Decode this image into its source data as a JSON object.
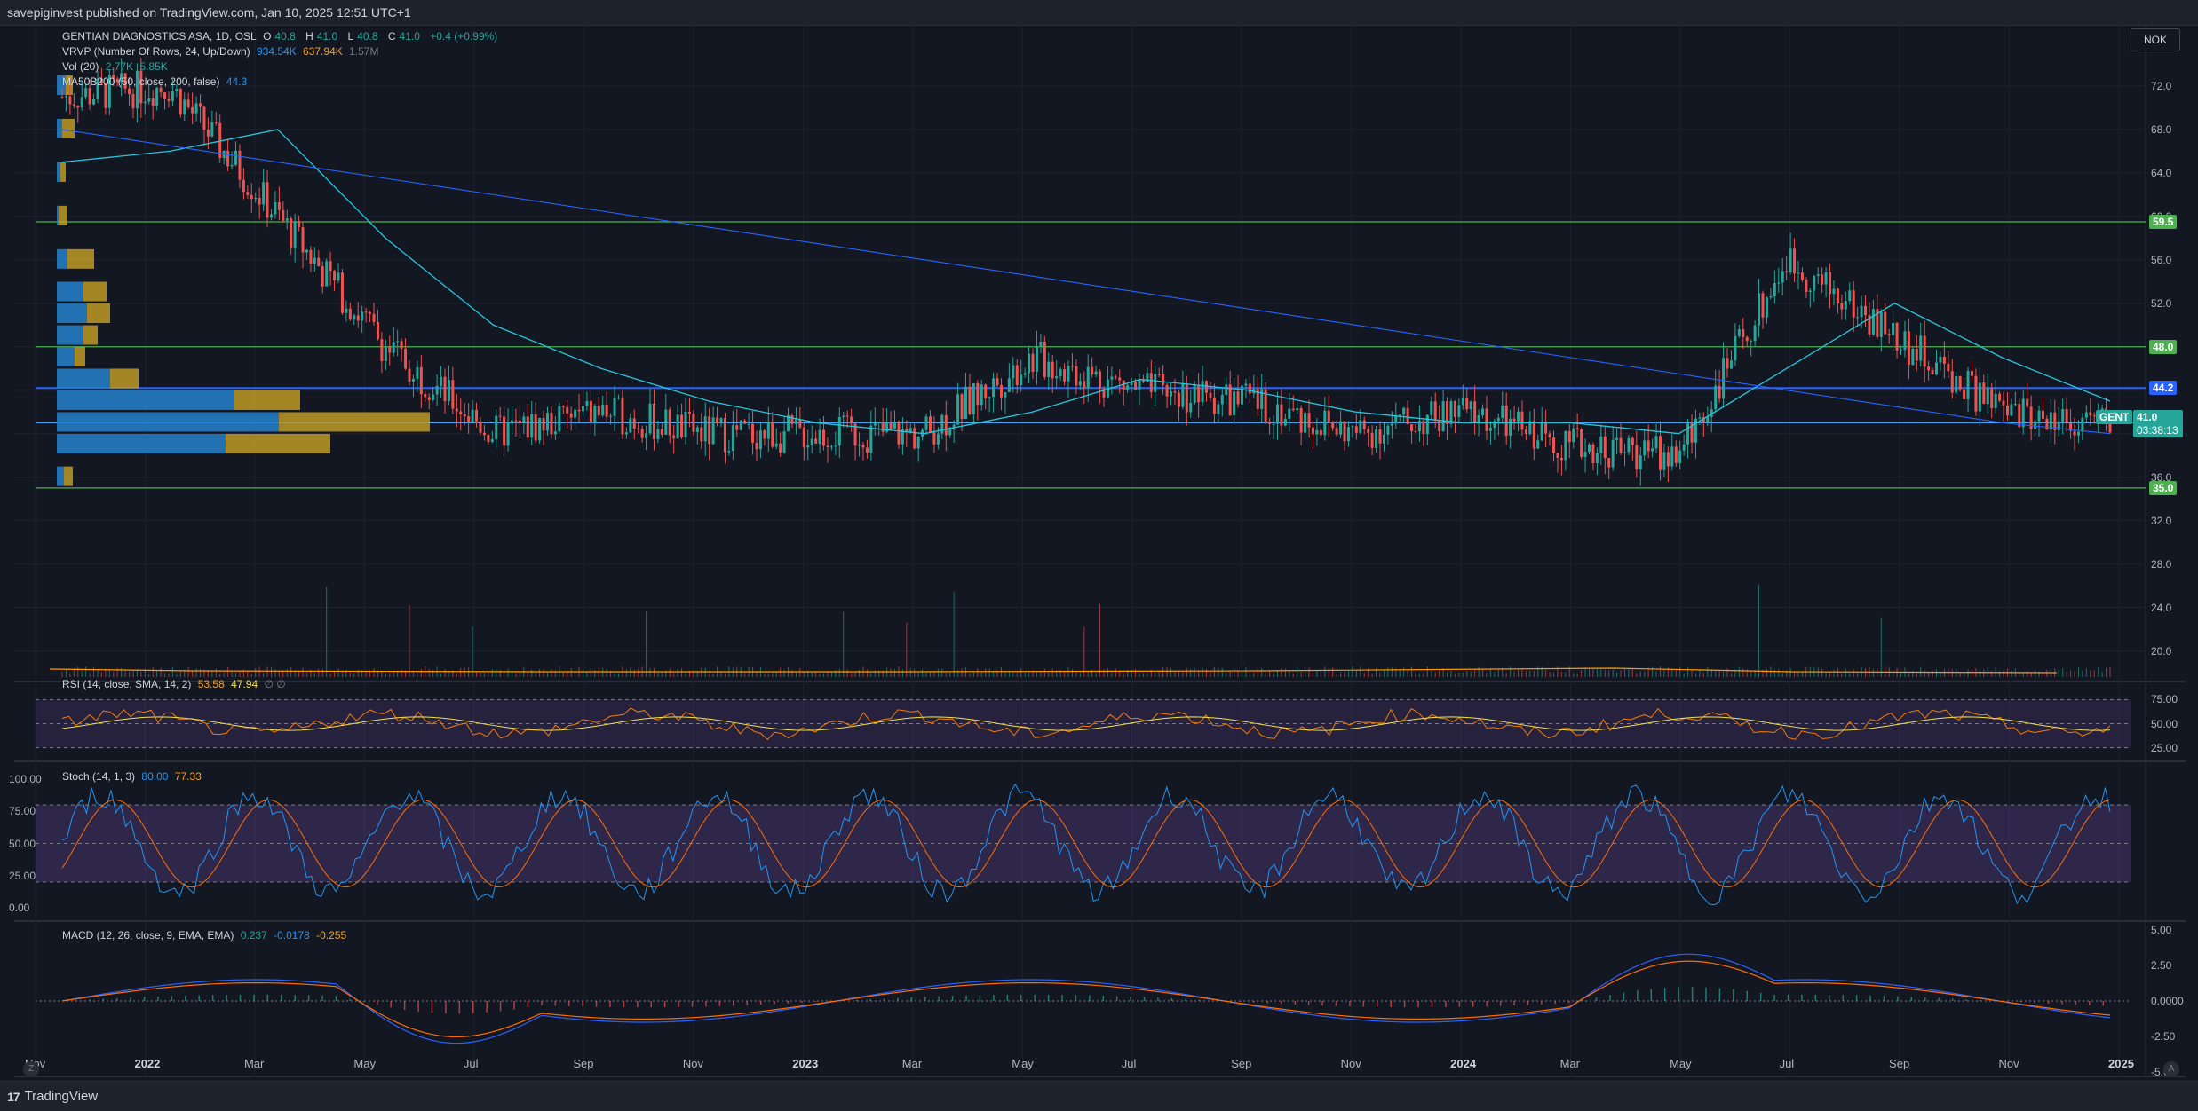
{
  "header": {
    "published": "savepiginvest published on TradingView.com, Jan 10, 2025 12:51 UTC+1"
  },
  "footer": {
    "brand": "TradingView",
    "logo": "17"
  },
  "currency_button": "NOK",
  "corner_left": "Z",
  "corner_right": "A",
  "legend": {
    "symbol": "GENTIAN DIAGNOSTICS ASA, 1D, OSL",
    "ohlc": {
      "o_label": "O",
      "o": "40.8",
      "h_label": "H",
      "h": "41.0",
      "l_label": "L",
      "l": "40.8",
      "c_label": "C",
      "c": "41.0",
      "chg": "+0.4 (+0.99%)"
    },
    "vrvp": {
      "label": "VRVP (Number Of Rows, 24, Up/Down)",
      "up": "934.54K",
      "down": "637.94K",
      "total": "1.57M"
    },
    "vol": {
      "label": "Vol (20)",
      "v1": "2.77K",
      "v2": "5.85K"
    },
    "ma": {
      "label": "MA50B200 (50, close, 200, false)",
      "v": "44.3"
    },
    "rsi": {
      "label": "RSI (14, close, SMA, 14, 2)",
      "v1": "53.58",
      "v2": "47.94",
      "v3": "∅ ∅"
    },
    "stoch": {
      "label": "Stoch (14, 1, 3)",
      "k": "80.00",
      "d": "77.33"
    },
    "macd": {
      "label": "MACD (12, 26, close, 9, EMA, EMA)",
      "hist": "0.237",
      "macd": "-0.0178",
      "signal": "-0.255"
    }
  },
  "price_axis": [
    "72.0",
    "68.0",
    "64.0",
    "60.0",
    "56.0",
    "52.0",
    "48.0",
    "44.0",
    "40.0",
    "36.0",
    "32.0",
    "28.0",
    "24.0",
    "20.0"
  ],
  "level_badges": [
    {
      "text": "59.5",
      "color": "#4caf50"
    },
    {
      "text": "48.0",
      "color": "#4caf50"
    },
    {
      "text": "44.2",
      "color": "#2962ff"
    },
    {
      "text": "41.0",
      "color": "#42a5f5"
    },
    {
      "text": "35.0",
      "color": "#4caf50"
    }
  ],
  "current_price": {
    "ticker": "GENT",
    "price": "41.0",
    "countdown": "03:38:13",
    "color": "#26a69a"
  },
  "rsi_axis": [
    "75.00",
    "50.00",
    "25.00"
  ],
  "stoch_axis": [
    "100.00",
    "75.00",
    "50.00",
    "25.00",
    "0.00"
  ],
  "macd_axis": [
    "5.00",
    "2.50",
    "0.0000",
    "-2.50",
    "-5.00"
  ],
  "time_axis": [
    {
      "t": "Nov",
      "bold": false
    },
    {
      "t": "2022",
      "bold": true
    },
    {
      "t": "Mar",
      "bold": false
    },
    {
      "t": "May",
      "bold": false
    },
    {
      "t": "Jul",
      "bold": false
    },
    {
      "t": "Sep",
      "bold": false
    },
    {
      "t": "Nov",
      "bold": false
    },
    {
      "t": "2023",
      "bold": true
    },
    {
      "t": "Mar",
      "bold": false
    },
    {
      "t": "May",
      "bold": false
    },
    {
      "t": "Jul",
      "bold": false
    },
    {
      "t": "Sep",
      "bold": false
    },
    {
      "t": "Nov",
      "bold": false
    },
    {
      "t": "2024",
      "bold": true
    },
    {
      "t": "Mar",
      "bold": false
    },
    {
      "t": "May",
      "bold": false
    },
    {
      "t": "Jul",
      "bold": false
    },
    {
      "t": "Sep",
      "bold": false
    },
    {
      "t": "Nov",
      "bold": false
    },
    {
      "t": "2025",
      "bold": true
    }
  ],
  "colors": {
    "up": "#26a69a",
    "down": "#ef5350",
    "ma50": "#26c6da",
    "ma200": "#2962ff",
    "rsi": "#f57c00",
    "rsi_ma": "#f0e04c",
    "stoch_k": "#2196f3",
    "stoch_d": "#ff6d00",
    "band": "#7e57c2"
  },
  "chart_data": {
    "type": "line",
    "title": "GENTIAN DIAGNOSTICS ASA, 1D, OSL",
    "x": [
      "Nov",
      "2022",
      "Mar",
      "May",
      "Jul",
      "Sep",
      "Nov",
      "2023",
      "Mar",
      "May",
      "Jul",
      "Sep",
      "Nov",
      "2024",
      "Mar",
      "May",
      "Jul",
      "Sep",
      "Nov",
      "2025"
    ],
    "series": [
      {
        "name": "Price",
        "values": [
          71,
          72,
          60,
          48,
          40,
          42,
          40,
          40,
          40,
          47,
          44,
          43,
          40,
          42,
          39,
          38,
          56,
          49,
          42,
          41
        ]
      },
      {
        "name": "MA50B200",
        "values": [
          65,
          66,
          68,
          58,
          50,
          46,
          43,
          41,
          40,
          42,
          45,
          44,
          42,
          41,
          41,
          40,
          46,
          52,
          47,
          43
        ]
      }
    ],
    "horizontal_levels": [
      59.5,
      48.0,
      44.2,
      41.0,
      35.0
    ],
    "ylim": [
      18,
      76
    ],
    "rsi_levels": [
      75,
      50,
      25
    ],
    "stoch_levels": [
      100,
      75,
      50,
      25,
      0
    ],
    "macd_range": [
      -5,
      5
    ]
  }
}
